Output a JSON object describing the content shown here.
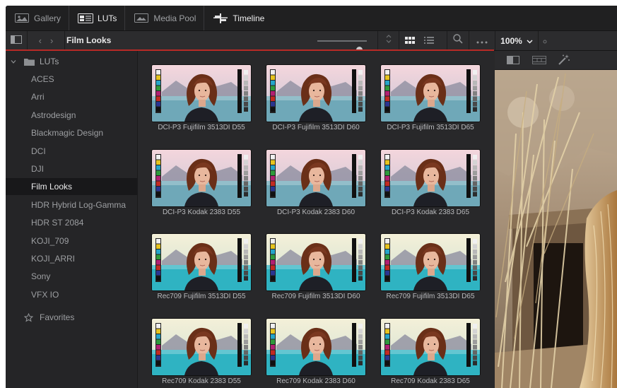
{
  "tabs": [
    {
      "label": "Gallery",
      "icon": "gallery-icon",
      "active": false
    },
    {
      "label": "LUTs",
      "icon": "luts-icon",
      "active": true
    },
    {
      "label": "Media Pool",
      "icon": "media-pool-icon",
      "active": false
    },
    {
      "label": "Timeline",
      "icon": "timeline-icon",
      "active": true
    }
  ],
  "toolbar": {
    "current_folder": "Film Looks",
    "zoom": "100%",
    "thumbnail_size": 0.85
  },
  "sidebar": {
    "root_label": "LUTs",
    "items": [
      {
        "label": "ACES"
      },
      {
        "label": "Arri"
      },
      {
        "label": "Astrodesign"
      },
      {
        "label": "Blackmagic Design"
      },
      {
        "label": "DCI"
      },
      {
        "label": "DJI"
      },
      {
        "label": "Film Looks",
        "active": true
      },
      {
        "label": "HDR Hybrid Log-Gamma"
      },
      {
        "label": "HDR ST 2084"
      },
      {
        "label": "KOJI_709"
      },
      {
        "label": "KOJI_ARRI"
      },
      {
        "label": "Sony"
      },
      {
        "label": "VFX IO"
      }
    ],
    "favorites_label": "Favorites"
  },
  "luts": [
    {
      "name": "DCI-P3 Fujifilm 3513DI D55"
    },
    {
      "name": "DCI-P3 Fujifilm 3513DI D60"
    },
    {
      "name": "DCI-P3 Fujifilm 3513DI D65"
    },
    {
      "name": "DCI-P3 Kodak 2383 D55"
    },
    {
      "name": "DCI-P3 Kodak 2383 D60"
    },
    {
      "name": "DCI-P3 Kodak 2383 D65"
    },
    {
      "name": "Rec709 Fujifilm 3513DI D55"
    },
    {
      "name": "Rec709 Fujifilm 3513DI D60"
    },
    {
      "name": "Rec709 Fujifilm 3513DI D65"
    },
    {
      "name": "Rec709 Kodak 2383 D55"
    },
    {
      "name": "Rec709 Kodak 2383 D60"
    },
    {
      "name": "Rec709 Kodak 2383 D65"
    }
  ],
  "colors": {
    "accent": "#b82a26",
    "background": "#282829"
  }
}
